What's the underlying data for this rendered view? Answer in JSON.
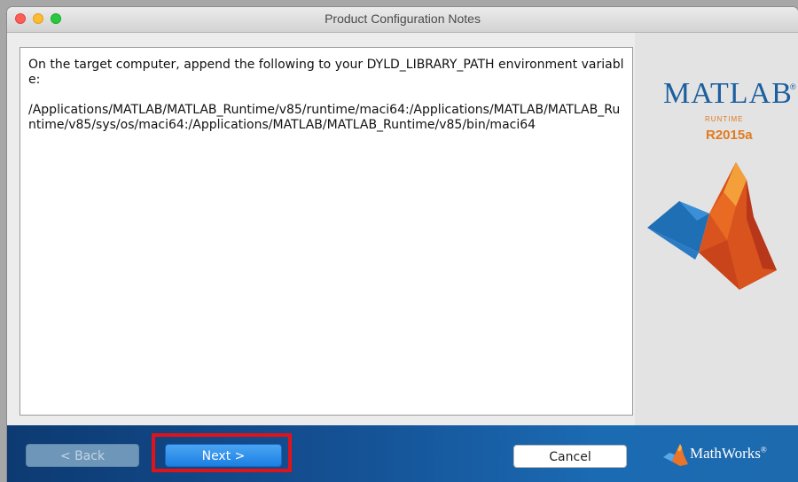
{
  "window": {
    "title": "Product Configuration Notes"
  },
  "notes": {
    "line1": "On the target computer, append the following to your DYLD_LIBRARY_PATH environment variable:",
    "path": "/Applications/MATLAB/MATLAB_Runtime/v85/runtime/maci64:/Applications/MATLAB/MATLAB_Runtime/v85/sys/os/maci64:/Applications/MATLAB/MATLAB_Runtime/v85/bin/maci64"
  },
  "branding": {
    "product": "MATLAB",
    "registered": "®",
    "subtitle": "RUNTIME",
    "release": "R2015a",
    "vendor": "MathWorks",
    "vendor_mark": "®"
  },
  "buttons": {
    "back": "< Back",
    "next": "Next >",
    "cancel": "Cancel"
  },
  "colors": {
    "highlight": "#e0131b",
    "brand_blue": "#1b5f9e",
    "brand_orange": "#e07b1e"
  }
}
